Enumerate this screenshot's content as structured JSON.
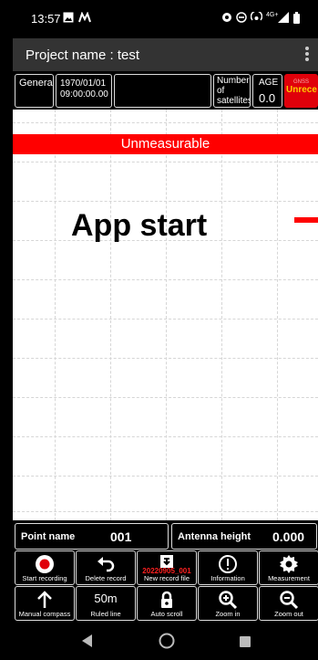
{
  "status_bar": {
    "time": "13:57",
    "icons": [
      "image-icon",
      "m-logo-icon",
      "location-icon",
      "dnd-icon",
      "hotspot-icon",
      "4g-signal-icon",
      "battery-icon"
    ],
    "network": "4G+"
  },
  "app_bar": {
    "title": "Project name : test",
    "menu_icon": "overflow-menu-icon"
  },
  "info_row": {
    "mode": "General",
    "datetime_line1": "1970/01/01",
    "datetime_line2": "09:00:00.00",
    "satellites_label": "Number of satellites",
    "age_label": "AGE",
    "age_value": "0.0",
    "gnss_label": "GNSS",
    "gnss_status": "Unreceived",
    "gnss_color": "#e0000a"
  },
  "plot": {
    "status_banner": "Unmeasurable",
    "overlay_text": "App start",
    "banner_color": "#ff0000"
  },
  "point_row": {
    "point_name_label": "Point name",
    "point_name_value": "001",
    "antenna_height_label": "Antenna height",
    "antenna_height_value": "0.000"
  },
  "buttons": {
    "start_recording": "Start recording",
    "delete_record": "Delete record",
    "new_record_file": "New record file",
    "new_record_file_name": "20220905_001",
    "information": "Information",
    "measurement": "Measurement",
    "manual_compass": "Manual compass",
    "ruled_line": "Ruled line",
    "ruled_line_value": "50m",
    "auto_scroll": "Auto scroll",
    "zoom_in": "Zoom in",
    "zoom_out": "Zoom out"
  },
  "nav_bar": {
    "back_icon": "back-icon",
    "home_icon": "home-icon",
    "recents_icon": "recents-icon"
  }
}
